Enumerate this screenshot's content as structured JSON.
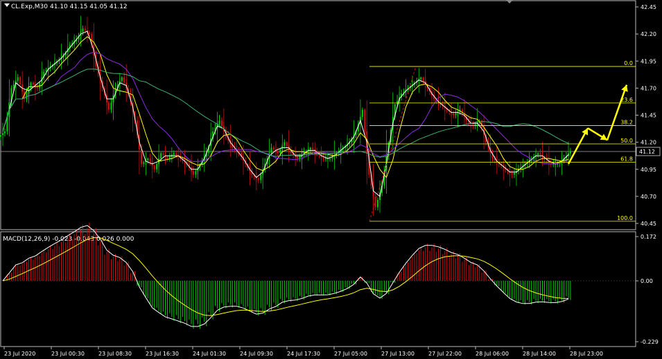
{
  "header": {
    "symbol_label": "CL.Exp,M30",
    "ohlc_label": "41.10 41.15 41.05 41.12"
  },
  "macd_panel": {
    "label": "MACD(12,26,9) -0.023 -0.043 0.026 0.000"
  },
  "colors": {
    "background": "#000000",
    "bull": "#00d000",
    "bear": "#d01010",
    "ma_fast": "#ffffff",
    "ma_mid": "#ffff00",
    "ma_slow": "#8a2be2",
    "ma_long": "#3cb371",
    "macd_line": "#ffffff",
    "signal_line": "#ffff00",
    "fib": "#ffff00",
    "arrow": "#ffff00",
    "grid": "#ffffff"
  },
  "chart_data": [
    {
      "type": "candlestick",
      "ylim": [
        40.45,
        42.45
      ],
      "yticks": [
        "42.45",
        "42.20",
        "41.95",
        "41.70",
        "41.45",
        "41.20",
        "40.95",
        "40.70",
        "40.45"
      ],
      "xticks": [
        "23 Jul 2020",
        "23 Jul 00:30",
        "23 Jul 08:30",
        "23 Jul 16:30",
        "24 Jul 01:30",
        "24 Jul 09:30",
        "24 Jul 17:30",
        "27 Jul 05:00",
        "27 Jul 13:00",
        "27 Jul 22:00",
        "28 Jul 06:00",
        "28 Jul 14:00",
        "28 Jul 23:00"
      ],
      "current_price": "41.12",
      "fibonacci": {
        "levels": [
          "0.0",
          "23.6",
          "38.2",
          "50.0",
          "61.8",
          "100.0"
        ],
        "high": 41.9,
        "low": 40.47
      },
      "close_series": [
        41.3,
        41.7,
        41.8,
        41.6,
        41.75,
        41.7,
        41.85,
        41.9,
        41.95,
        42.0,
        42.1,
        42.15,
        42.25,
        42.2,
        41.9,
        41.7,
        41.5,
        41.7,
        41.8,
        41.65,
        41.4,
        41.0,
        41.05,
        40.95,
        41.1,
        41.05,
        41.1,
        41.05,
        41.0,
        40.9,
        41.0,
        41.1,
        41.3,
        41.4,
        41.25,
        41.15,
        41.1,
        41.0,
        40.9,
        40.85,
        41.0,
        41.15,
        41.1,
        41.2,
        41.1,
        41.05,
        41.1,
        41.15,
        41.1,
        41.05,
        41.05,
        41.1,
        41.15,
        41.2,
        41.3,
        41.5,
        40.9,
        40.6,
        40.8,
        41.2,
        41.55,
        41.65,
        41.7,
        41.75,
        41.8,
        41.7,
        41.6,
        41.55,
        41.5,
        41.45,
        41.5,
        41.4,
        41.35,
        41.4,
        41.2,
        41.05,
        41.0,
        40.95,
        40.9,
        40.95,
        41.0,
        41.05,
        41.1,
        41.05,
        41.0,
        41.0,
        41.05,
        41.12
      ],
      "projection_arrows": [
        {
          "from": [
            41.0,
            0
          ],
          "to": [
            41.33,
            1
          ]
        },
        {
          "from": [
            41.33,
            1
          ],
          "to": [
            41.22,
            2
          ]
        },
        {
          "from": [
            41.22,
            2
          ],
          "to": [
            41.73,
            3
          ]
        }
      ]
    },
    {
      "type": "histogram",
      "title": "MACD(12,26,9)",
      "yticks": [
        "0.172",
        "0.00",
        "-0.229"
      ],
      "ylim": [
        -0.229,
        0.172
      ]
    }
  ]
}
